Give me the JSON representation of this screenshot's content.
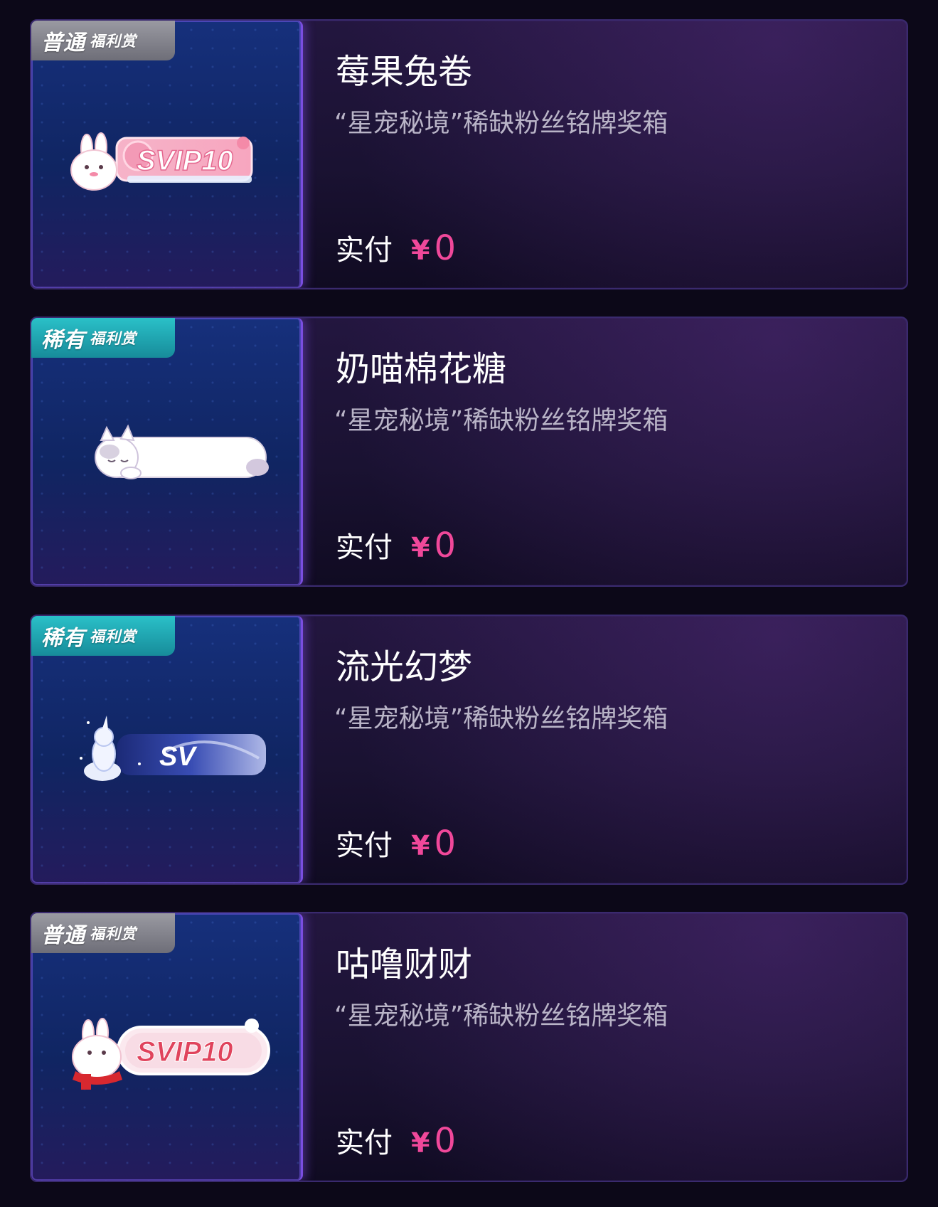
{
  "items": [
    {
      "badge": {
        "tier": "普通",
        "label": "福利赏",
        "style": "normal"
      },
      "medal": {
        "icon": "rabbit-svip-medal-icon",
        "text": "SVIP10"
      },
      "title": "莓果兔卷",
      "description": "“星宠秘境”稀缺粉丝铭牌奖箱",
      "pay_label": "实付",
      "currency": "¥",
      "price": "0"
    },
    {
      "badge": {
        "tier": "稀有",
        "label": "福利赏",
        "style": "rare"
      },
      "medal": {
        "icon": "sleeping-cat-medal-icon",
        "text": ""
      },
      "title": "奶喵棉花糖",
      "description": "“星宠秘境”稀缺粉丝铭牌奖箱",
      "pay_label": "实付",
      "currency": "¥",
      "price": "0"
    },
    {
      "badge": {
        "tier": "稀有",
        "label": "福利赏",
        "style": "rare"
      },
      "medal": {
        "icon": "unicorn-starry-medal-icon",
        "text": "SV"
      },
      "title": "流光幻梦",
      "description": "“星宠秘境”稀缺粉丝铭牌奖箱",
      "pay_label": "实付",
      "currency": "¥",
      "price": "0"
    },
    {
      "badge": {
        "tier": "普通",
        "label": "福利赏",
        "style": "normal"
      },
      "medal": {
        "icon": "rabbit-scarf-svip-medal-icon",
        "text": "SVIP10"
      },
      "title": "咕噜财财",
      "description": "“星宠秘境”稀缺粉丝铭牌奖箱",
      "pay_label": "实付",
      "currency": "¥",
      "price": "0"
    }
  ],
  "colors": {
    "price": "#f0489a",
    "badge_normal": "#8a8a94",
    "badge_rare": "#21a8b3",
    "card_border": "#3a2a6e",
    "thumb_bg": "#122868"
  }
}
